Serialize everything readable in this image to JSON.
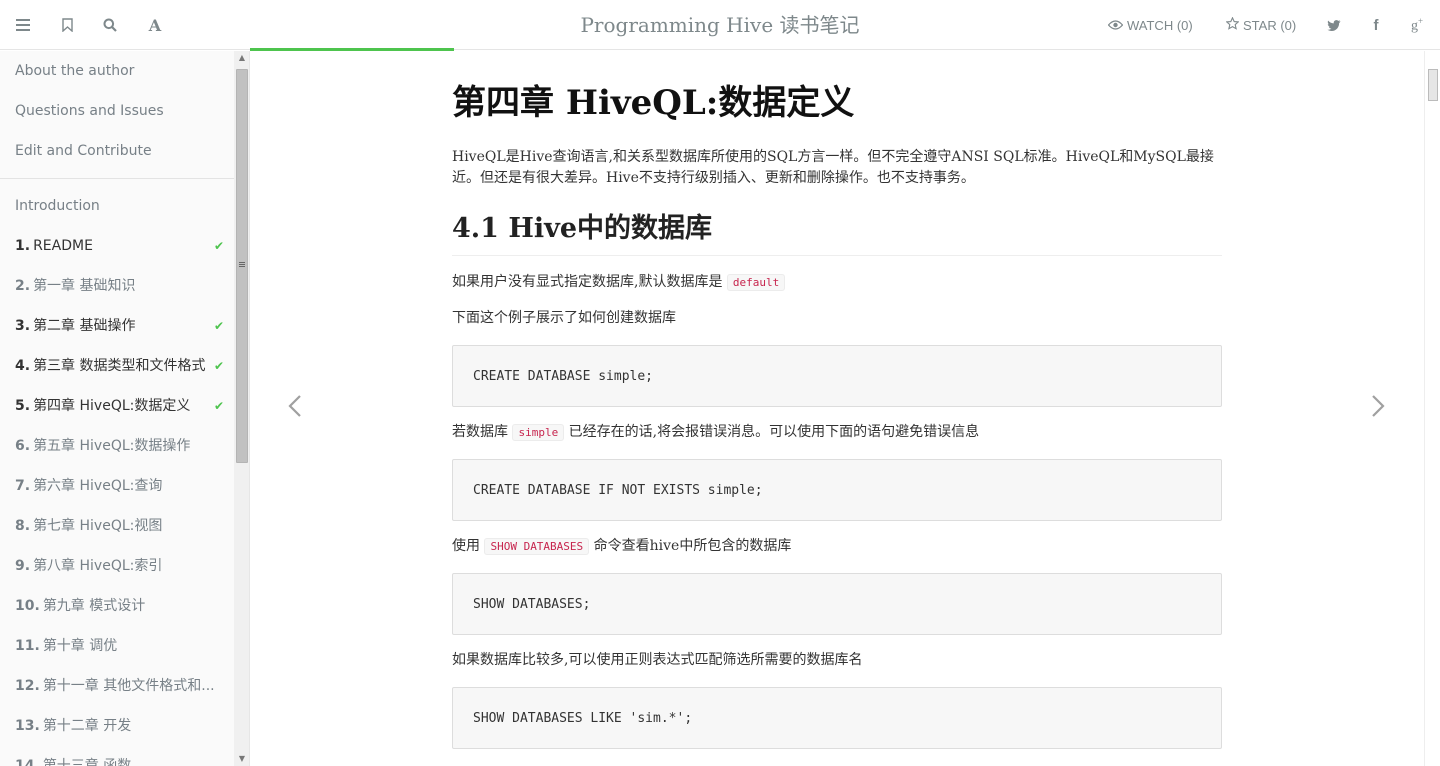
{
  "header": {
    "title": "Programming Hive 读书笔记",
    "watch_label": "WATCH (0)",
    "star_label": "STAR (0)"
  },
  "sidebar": {
    "top_links": [
      "About the author",
      "Questions and Issues",
      "Edit and Contribute"
    ],
    "introduction": "Introduction",
    "items": [
      {
        "num": "1.",
        "label": "README",
        "checked": true,
        "visited": true
      },
      {
        "num": "2.",
        "label": "第一章 基础知识",
        "checked": false,
        "visited": false
      },
      {
        "num": "3.",
        "label": "第二章 基础操作",
        "checked": true,
        "visited": true
      },
      {
        "num": "4.",
        "label": "第三章 数据类型和文件格式",
        "checked": true,
        "visited": true
      },
      {
        "num": "5.",
        "label": "第四章 HiveQL:数据定义",
        "checked": true,
        "visited": true
      },
      {
        "num": "6.",
        "label": "第五章 HiveQL:数据操作",
        "checked": false,
        "visited": false
      },
      {
        "num": "7.",
        "label": "第六章 HiveQL:查询",
        "checked": false,
        "visited": false
      },
      {
        "num": "8.",
        "label": "第七章 HiveQL:视图",
        "checked": false,
        "visited": false
      },
      {
        "num": "9.",
        "label": "第八章 HiveQL:索引",
        "checked": false,
        "visited": false
      },
      {
        "num": "10.",
        "label": "第九章 模式设计",
        "checked": false,
        "visited": false
      },
      {
        "num": "11.",
        "label": "第十章 调优",
        "checked": false,
        "visited": false
      },
      {
        "num": "12.",
        "label": "第十一章 其他文件格式和...",
        "checked": false,
        "visited": false
      },
      {
        "num": "13.",
        "label": "第十二章 开发",
        "checked": false,
        "visited": false
      },
      {
        "num": "14.",
        "label": "第十三章 函数",
        "checked": false,
        "visited": false
      }
    ]
  },
  "content": {
    "chapter_title": "第四章 HiveQL:数据定义",
    "intro": "HiveQL是Hive查询语言,和关系型数据库所使用的SQL方言一样。但不完全遵守ANSI SQL标准。HiveQL和MySQL最接近。但还是有很大差异。Hive不支持行级别插入、更新和删除操作。也不支持事务。",
    "section_title": "4.1 Hive中的数据库",
    "p1_text": "如果用户没有显式指定数据库,默认数据库是",
    "p1_code": "default",
    "p2_text": "下面这个例子展示了如何创建数据库",
    "code1": "CREATE DATABASE simple;",
    "p3_pre": "若数据库",
    "p3_code": "simple",
    "p3_post": "已经存在的话,将会报错误消息。可以使用下面的语句避免错误信息",
    "code2": "CREATE DATABASE IF NOT EXISTS simple;",
    "p4_pre": "使用",
    "p4_code": "SHOW DATABASES",
    "p4_post": "命令查看hive中所包含的数据库",
    "code3": "SHOW DATABASES;",
    "p5_text": "如果数据库比较多,可以使用正则表达式匹配筛选所需要的数据库名",
    "code4": "SHOW DATABASES LIKE 'sim.*';"
  },
  "nav": {
    "prev_glyph": "‹",
    "next_glyph": "›"
  },
  "colors": {
    "accent_green": "#4ec44e",
    "sidebar_bg": "#fafafa",
    "inline_code": "#c7254e"
  }
}
